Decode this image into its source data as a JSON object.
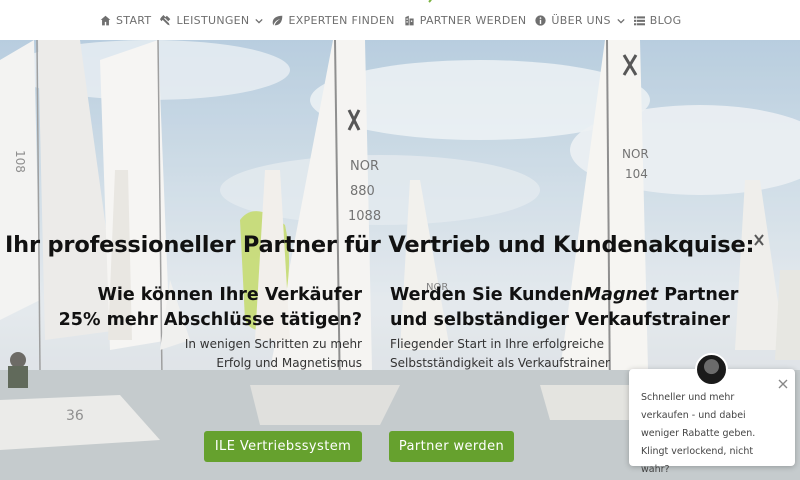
{
  "nav": {
    "items": [
      {
        "label": "START",
        "icon": "home-icon"
      },
      {
        "label": "LEISTUNGEN",
        "icon": "tools-icon",
        "dropdown": true
      },
      {
        "label": "EXPERTEN FINDEN",
        "icon": "leaf-icon"
      },
      {
        "label": "PARTNER WERDEN",
        "icon": "building-icon"
      },
      {
        "label": "ÜBER UNS",
        "icon": "info-icon",
        "dropdown": true
      },
      {
        "label": "BLOG",
        "icon": "list-icon"
      }
    ]
  },
  "hero": {
    "headline": "Ihr professioneller Partner für Vertrieb und Kundenakquise:",
    "left": {
      "title_line1": "Wie können Ihre Verkäufer",
      "title_line2": "25% mehr Abschlüsse tätigen?",
      "text_line1": "In wenigen Schritten zu mehr",
      "text_line2": "Erfolg und Magnetismus",
      "button": "ILE Vertriebssystem"
    },
    "right": {
      "title_prefix": "Werden Sie Kunden",
      "title_em": "Magnet",
      "title_suffix": " Partner",
      "title_line2": "und selbständiger Verkaufstrainer",
      "text_line1": "Fliegender Start in Ihre erfolgreiche",
      "text_line2": "Selbstständigkeit als Verkaufstrainer",
      "button": "Partner werden"
    },
    "sail_numbers": [
      "NOR",
      "880",
      "1088",
      "NOR",
      "104"
    ]
  },
  "chat": {
    "message": "Schneller und mehr verkaufen - und dabei weniger Rabatte geben. Klingt verlockend, nicht wahr?"
  },
  "colors": {
    "accent": "#66a12e",
    "nav_text": "#6f6f6f",
    "headline": "#111111"
  }
}
